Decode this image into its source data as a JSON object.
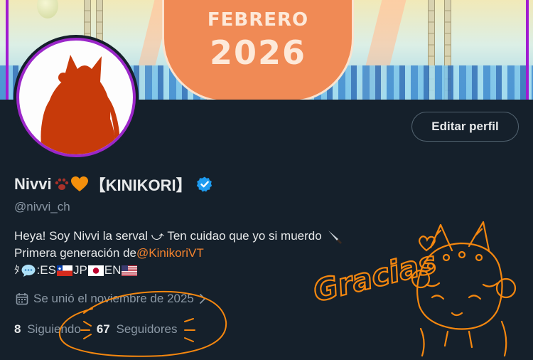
{
  "banner": {
    "month": "FEBRERO",
    "year": "2026"
  },
  "profile": {
    "edit_button": "Editar perfil",
    "name": "Nivvi",
    "name_tag": "【KINIKORI】",
    "handle": "@nivvi_ch",
    "bio_line1": "Heya! Soy Nivvi la serval ⤻ Ten cuidao que yo si muerdo",
    "bio_line2_prefix": "Primera generación de ",
    "bio_line2_link": "@KinikoriVT",
    "bio_line3_prefix": "ﾀ",
    "bio_line3_es": "ES",
    "bio_line3_jp": "JP",
    "bio_line3_en": "EN",
    "joined": "Se unió el noviembre de 2025",
    "following_count": "8",
    "following_label": "Siguiendo",
    "followers_count": "67",
    "followers_label": "Seguidores"
  },
  "doodle": {
    "text": "Gracias"
  },
  "colors": {
    "background": "#15202b",
    "accent_orange": "#f4832e",
    "verified_blue": "#1d9bf0",
    "avatar_border": "#9b27c9",
    "doodle_orange": "#f5870f"
  },
  "icons": [
    "paw-icon",
    "heart-icon",
    "verified-icon",
    "speech-bubble-icon",
    "knife-icon",
    "calendar-icon",
    "chevron-right-icon"
  ]
}
